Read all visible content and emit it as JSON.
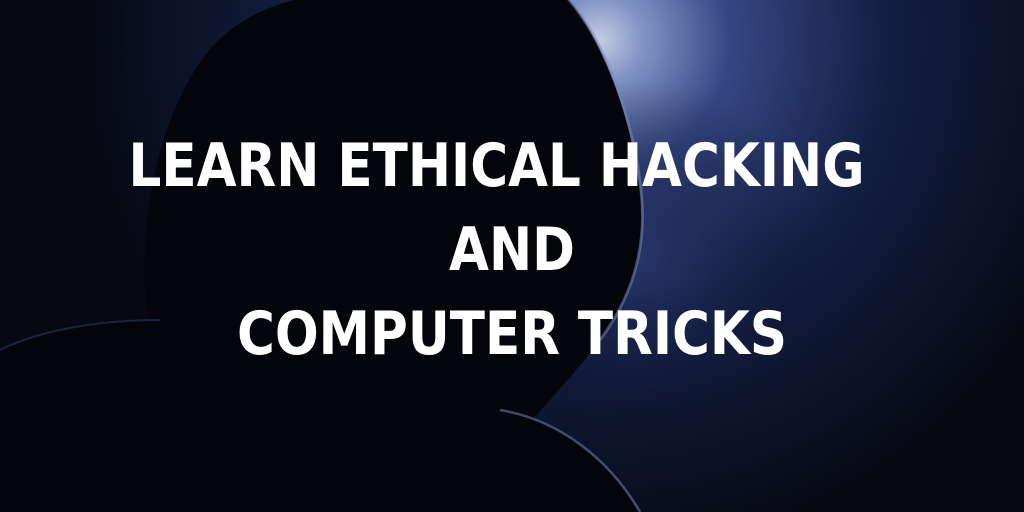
{
  "headline": {
    "line1": "LEARN ETHICAL HACKING",
    "line2": "AND",
    "line3": "COMPUTER TRICKS"
  },
  "colors": {
    "background": "#070a14",
    "glow": "#8ea2d8",
    "text": "#ffffff"
  },
  "image": {
    "subject": "hooded-figure-silhouette"
  }
}
